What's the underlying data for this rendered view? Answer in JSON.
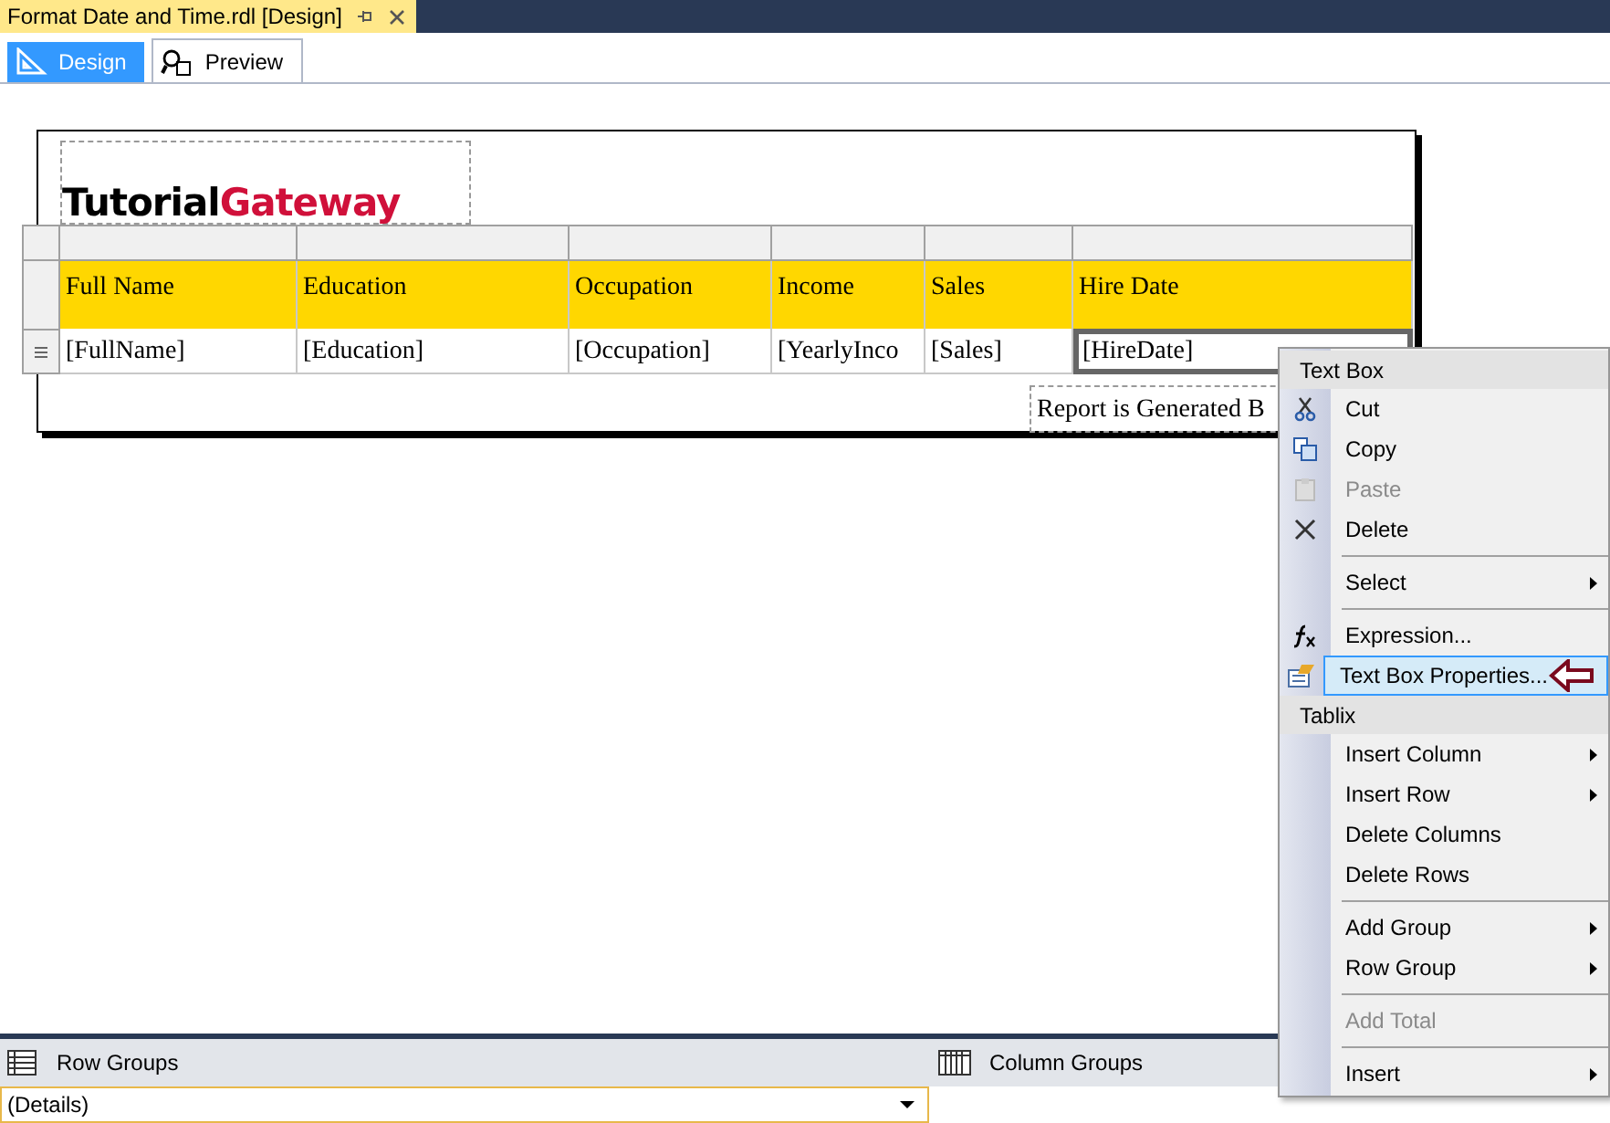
{
  "document_tab": {
    "title": "Format Date and Time.rdl [Design]"
  },
  "view_tabs": [
    {
      "label": "Design",
      "selected": true
    },
    {
      "label": "Preview",
      "selected": false
    }
  ],
  "report": {
    "logo": {
      "part_1": "Tutorial",
      "part_2": "Gateway"
    },
    "header_cells": [
      "Full Name",
      "Education",
      "Occupation",
      "Income",
      "Sales",
      "Hire Date"
    ],
    "detail_cells": [
      {
        "text": "[FullName]",
        "selected": false
      },
      {
        "text": "[Education]",
        "selected": false
      },
      {
        "text": "[Occupation]",
        "selected": false
      },
      {
        "text": "[YearlyInco",
        "selected": false
      },
      {
        "text": "[Sales]",
        "selected": false
      },
      {
        "text": "[HireDate]",
        "selected": true
      }
    ],
    "footer_text": "Report is Generated B"
  },
  "context_menu": [
    {
      "kind": "header",
      "label": "Text Box"
    },
    {
      "kind": "item",
      "label": "Cut",
      "disabled": false,
      "submenu": false,
      "selected": false
    },
    {
      "kind": "item",
      "label": "Copy",
      "disabled": false,
      "submenu": false,
      "selected": false
    },
    {
      "kind": "item",
      "label": "Paste",
      "disabled": true,
      "submenu": false,
      "selected": false
    },
    {
      "kind": "item",
      "label": "Delete",
      "disabled": false,
      "submenu": false,
      "selected": false
    },
    {
      "kind": "separator"
    },
    {
      "kind": "item",
      "label": "Select",
      "disabled": false,
      "submenu": true,
      "selected": false
    },
    {
      "kind": "separator"
    },
    {
      "kind": "item",
      "label": "Expression...",
      "disabled": false,
      "submenu": false,
      "selected": false
    },
    {
      "kind": "item",
      "label": "Text Box Properties...",
      "disabled": false,
      "submenu": false,
      "selected": true
    },
    {
      "kind": "header",
      "label": "Tablix"
    },
    {
      "kind": "item",
      "label": "Insert Column",
      "disabled": false,
      "submenu": true,
      "selected": false
    },
    {
      "kind": "item",
      "label": "Insert Row",
      "disabled": false,
      "submenu": true,
      "selected": false
    },
    {
      "kind": "item",
      "label": "Delete Columns",
      "disabled": false,
      "submenu": false,
      "selected": false
    },
    {
      "kind": "item",
      "label": "Delete Rows",
      "disabled": false,
      "submenu": false,
      "selected": false
    },
    {
      "kind": "separator"
    },
    {
      "kind": "item",
      "label": "Add Group",
      "disabled": false,
      "submenu": true,
      "selected": false
    },
    {
      "kind": "item",
      "label": "Row Group",
      "disabled": false,
      "submenu": true,
      "selected": false
    },
    {
      "kind": "separator"
    },
    {
      "kind": "item",
      "label": "Add Total",
      "disabled": true,
      "submenu": false,
      "selected": false
    },
    {
      "kind": "separator"
    },
    {
      "kind": "item",
      "label": "Insert",
      "disabled": false,
      "submenu": true,
      "selected": false
    }
  ],
  "grouping": {
    "row_groups_label": "Row Groups",
    "column_groups_label": "Column Groups",
    "details_value": "(Details)"
  }
}
